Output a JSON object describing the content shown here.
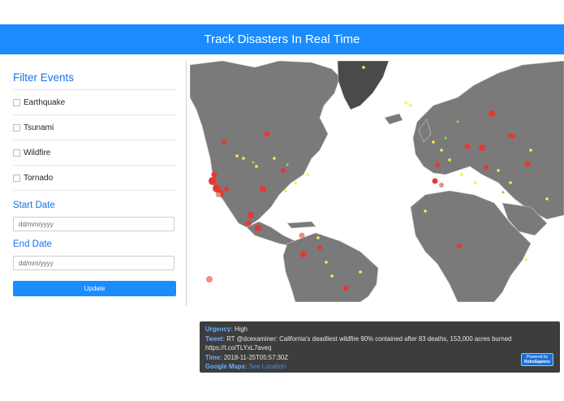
{
  "header": {
    "title": "Track Disasters In Real Time"
  },
  "sidebar": {
    "filter_title": "Filter Events",
    "filters": [
      {
        "label": "Earthquake",
        "checked": false
      },
      {
        "label": "Tsunami",
        "checked": false
      },
      {
        "label": "Wildfire",
        "checked": false
      },
      {
        "label": "Tornado",
        "checked": false
      }
    ],
    "start_date": {
      "label": "Start Date",
      "placeholder": "dd/mm/yyyy"
    },
    "end_date": {
      "label": "End Date",
      "placeholder": "dd/mm/yyyy"
    },
    "update_label": "Update"
  },
  "map": {
    "ocean_color": "#ffffff",
    "land_color": "#7a7a7a",
    "border_color": "#cfcfcf",
    "marker_colors": {
      "high": "#e53935",
      "high_faded": "#f28b82",
      "low": "#f5f242",
      "medium": "#7fdc4c"
    }
  },
  "info_window": {
    "urgency_key": "Urgency:",
    "urgency_value": "High",
    "tweet_key": "Tweet:",
    "tweet_value": "RT @dcexaminer: California's deadliest wildfire 90% contained after 83 deaths, 153,000 acres burned",
    "tweet_link": "https://t.co/TLYxL7aveq",
    "time_key": "Time:",
    "time_value": "2018-11-25T05:57:30Z",
    "maps_key": "Google Maps:",
    "maps_link": "See Location",
    "powered_line1": "Powered by",
    "powered_line2": "RoboSapiens"
  }
}
